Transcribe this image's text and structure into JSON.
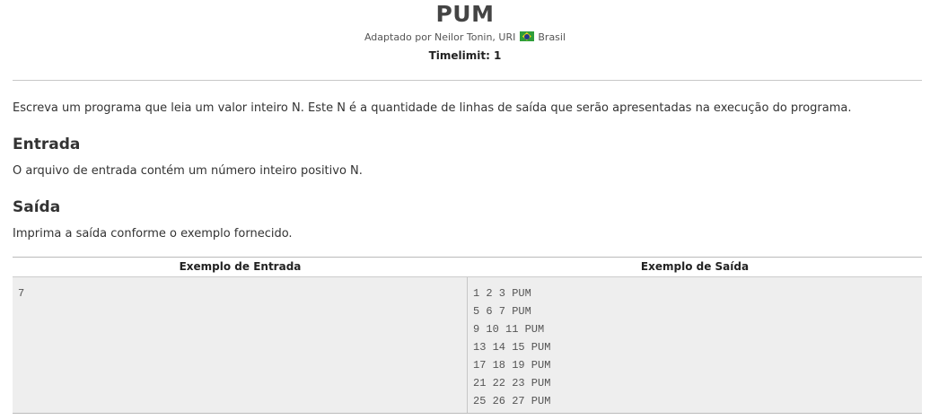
{
  "problem": {
    "title": "PUM",
    "credit_prefix": "Adaptado por Neilor Tonin, URI",
    "credit_country": "Brasil",
    "flag_icon": "brazil-flag-icon",
    "timelimit": "Timelimit: 1"
  },
  "description": "Escreva um programa que leia um valor inteiro N. Este N é a quantidade de linhas de saída que serão apresentadas na execução do programa.",
  "input_section": {
    "title": "Entrada",
    "text": "O arquivo de entrada contém um número inteiro positivo N."
  },
  "output_section": {
    "title": "Saída",
    "text": "Imprima a saída conforme o exemplo fornecido."
  },
  "examples": {
    "input_header": "Exemplo de Entrada",
    "output_header": "Exemplo de Saída",
    "input_lines": [
      "7"
    ],
    "output_lines": [
      "1 2 3 PUM",
      "5 6 7 PUM",
      "9 10 11 PUM",
      "13 14 15 PUM",
      "17 18 19 PUM",
      "21 22 23 PUM",
      "25 26 27 PUM"
    ]
  },
  "colors": {
    "divider": "#c8c8c8",
    "example_background": "#eeeeee",
    "flag_green": "#2f9e3a",
    "flag_yellow": "#f2d21b",
    "flag_blue": "#24398c"
  }
}
